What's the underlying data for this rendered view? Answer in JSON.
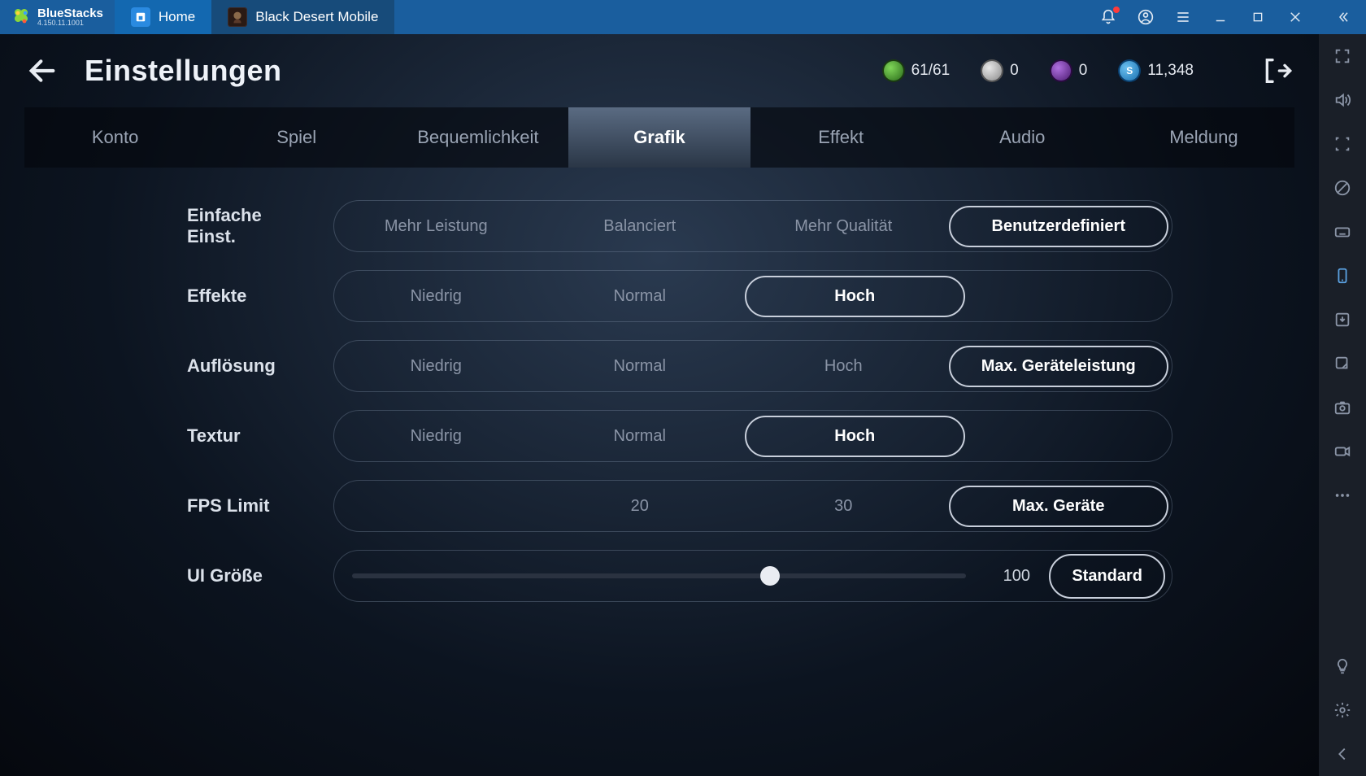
{
  "titlebar": {
    "logo_name": "BlueStacks",
    "logo_version": "4.150.11.1001",
    "tabs": [
      {
        "label": "Home"
      },
      {
        "label": "Black Desert Mobile"
      }
    ]
  },
  "game_header": {
    "title": "Einstellungen",
    "resources": [
      {
        "icon": "green",
        "value": "61/61"
      },
      {
        "icon": "silver",
        "value": "0"
      },
      {
        "icon": "purple",
        "value": "0"
      },
      {
        "icon": "blueS",
        "value": "11,348"
      }
    ]
  },
  "settings_tabs": [
    "Konto",
    "Spiel",
    "Bequemlichkeit",
    "Grafik",
    "Effekt",
    "Audio",
    "Meldung"
  ],
  "active_tab_index": 3,
  "settings": {
    "rows": [
      {
        "label": "Einfache Einst.",
        "options": [
          "Mehr Leistung",
          "Balanciert",
          "Mehr Qualität",
          "Benutzerdefiniert"
        ],
        "selected": 3
      },
      {
        "label": "Effekte",
        "options": [
          "Niedrig",
          "Normal",
          "Hoch",
          ""
        ],
        "selected": 2
      },
      {
        "label": "Auflösung",
        "options": [
          "Niedrig",
          "Normal",
          "Hoch",
          "Max. Geräteleistung"
        ],
        "selected": 3
      },
      {
        "label": "Textur",
        "options": [
          "Niedrig",
          "Normal",
          "Hoch",
          ""
        ],
        "selected": 2
      },
      {
        "label": "FPS Limit",
        "options": [
          "",
          "20",
          "30",
          "Max. Geräte"
        ],
        "selected": 3
      }
    ],
    "ui_size": {
      "label": "UI Größe",
      "value": "100",
      "percent": 68,
      "standard_label": "Standard"
    }
  },
  "side_rail": {
    "items": [
      "fullscreen",
      "volume",
      "focus",
      "visibility",
      "keyboard",
      "phone",
      "controller",
      "shortcut",
      "camera",
      "record",
      "more"
    ],
    "bottom": [
      "bulb",
      "gear",
      "collapse"
    ],
    "active_index": 5
  }
}
